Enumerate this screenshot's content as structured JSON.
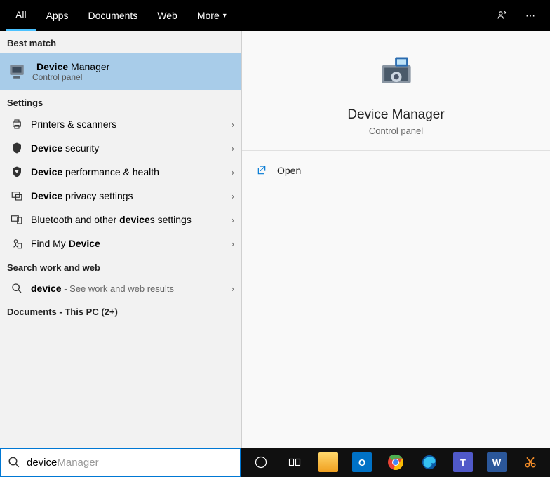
{
  "tabs": {
    "all": "All",
    "apps": "Apps",
    "documents": "Documents",
    "web": "Web",
    "more": "More"
  },
  "headings": {
    "best_match": "Best match",
    "settings": "Settings",
    "search_work": "Search work and web",
    "docs_thispc": "Documents - This PC (2+)"
  },
  "best": {
    "title_bold": "Device",
    "title_rest": " Manager",
    "sub": "Control panel"
  },
  "settings_items": [
    {
      "label_plain_pre": "Printers & scanners"
    },
    {
      "label_bold": "Device",
      "label_rest": " security"
    },
    {
      "label_bold": "Device",
      "label_rest": " performance & health"
    },
    {
      "label_bold": "Device",
      "label_rest": " privacy settings"
    },
    {
      "label_plain_pre": "Bluetooth and other ",
      "label_bold": "device",
      "label_rest": "s settings"
    },
    {
      "label_plain_pre": "Find My ",
      "label_bold": "Device"
    }
  ],
  "web_result": {
    "bold": "device",
    "rest": " - See work and web results"
  },
  "preview": {
    "title": "Device Manager",
    "sub": "Control panel",
    "open": "Open"
  },
  "search": {
    "typed": "device",
    "ghost_rest": " Manager"
  }
}
